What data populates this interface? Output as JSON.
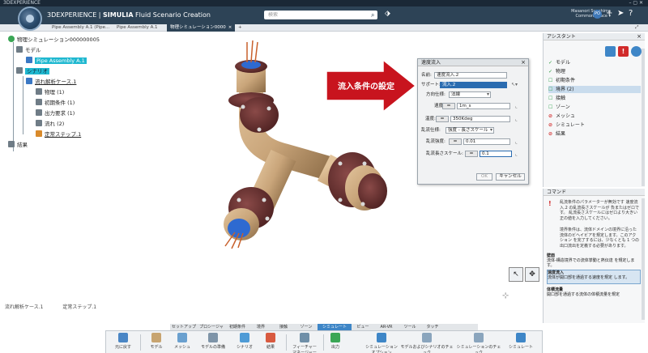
{
  "titlebar": {
    "text": "3DEXPERIENCE",
    "controls": "–  ▢  ✕"
  },
  "header": {
    "brand_main": "3DEXPERIENCE",
    "brand_sep": " | ",
    "brand_app": "SIMULIA",
    "brand_app_name": " Fluid Scenario Creation",
    "search_placeholder": "検索",
    "user_name": "Masanori Sunshima",
    "user_space": "Common Space ▾",
    "user_initials": "PO"
  },
  "tabs": [
    {
      "label": "Pipe Assembly A.1 (Pipe..."
    },
    {
      "label": "Pipe Assembly A.1"
    },
    {
      "label": "物理シミュレーション0000"
    }
  ],
  "tab_close": "×",
  "tree": {
    "root": "物理シミュレーション000000005",
    "model": "モデル",
    "pipe_assembly": "Pipe Assembly A.1",
    "scenario": "シナリオ",
    "fluid_case": "流れ解析ケース.1",
    "physics": "物理 (1)",
    "initial": "初期条件 (1)",
    "output": "出力要求 (1)",
    "flow": "流れ (2)",
    "steady": "定常ステップ.1",
    "results": "結果"
  },
  "status": {
    "item1": "流れ解析ケース.1",
    "item2": "定常ステップ.1"
  },
  "callout": {
    "text": "流入条件の設定"
  },
  "dialog": {
    "title": "速度流入",
    "name_label": "名前:",
    "name_value": "速度流入.2",
    "support_label": "サポート:",
    "support_value": "流入.2",
    "direction_label": "方向仕様:",
    "direction_value": "法線",
    "velocity_label": "速度:",
    "velocity_value": "1m_s",
    "temp_label": "温度:",
    "temp_value": "350Kdeg",
    "turb_label": "乱流仕様:",
    "turb_value": "強度 - 長さスケール",
    "intensity_label": "乱流強度:",
    "intensity_value": "0.01",
    "length_label": "乱流長さスケール:",
    "length_value": "0.1",
    "eq": "=",
    "ok": "OK",
    "cancel": "キャンセル"
  },
  "assistant": {
    "title": "アシスタント",
    "items": [
      "モデル",
      "物理",
      "初期条件",
      "境界 (2)",
      "接触",
      "ゾーン",
      "メッシュ",
      "シミュレート",
      "結果"
    ]
  },
  "command": {
    "title": "コマンド",
    "desc1": "乱流条件のパラメーターが無効です 速度流入.2 の乱流長さスケールが 負またはゼロです。 乱流長さスケールにはゼロより大きい 正の値を入力してください。",
    "desc2": "境界条件は、流体ドメインの境界に沿った 流体のビヘイビアを規定します。このアクション を完了するには、少なくとも 1 つの出口流出を定義する必要があります。",
    "entries": [
      {
        "title": "壁面",
        "desc": "流体-構造境界での流体挙動と熱伝達 を規定します。"
      },
      {
        "title": "速度流入",
        "desc": "流体が開口部を通過する速度を規定 します。"
      },
      {
        "title": "体積流量",
        "desc": "開口部を通過する流体の体積流量を規定"
      }
    ]
  },
  "sections": [
    "セットアップ",
    "プロシージャ",
    "初期条件",
    "境界",
    "接触",
    "ゾーン",
    "シミュレート",
    "ビュー",
    "AR-VR",
    "ツール",
    "タッチ"
  ],
  "actions": [
    "元に戻す",
    "モデル",
    "メッシュ",
    "モデルの準備",
    "シナリオ",
    "結果",
    "フィーチャー マネージャー",
    "出力",
    "シミュレーション オプション",
    "モデルおよびシナリオのチェック",
    "シミュレーションのチェック",
    "シミュレート"
  ],
  "colors": {
    "header": "#2d4356",
    "accent": "#3e86c7",
    "callout": "#c8141e",
    "model_tan": "#c9a57a",
    "flange": "#6a2e2e"
  }
}
